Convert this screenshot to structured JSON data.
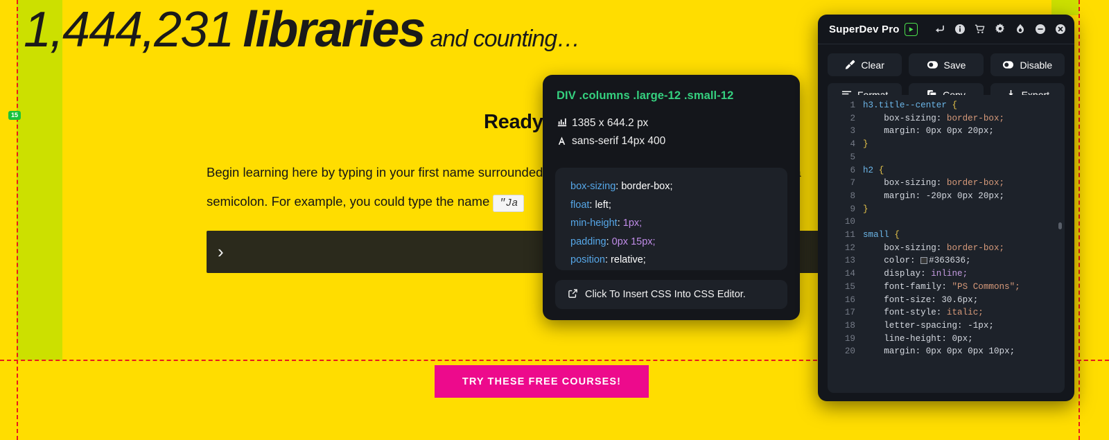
{
  "page": {
    "hero": {
      "count": "1,444,231",
      "word": "libraries",
      "tail": "and counting…"
    },
    "heading": "Ready to try",
    "body_line1": "Begin learning here by typing in your first name surrounded by double quotation marks and ending with a",
    "body_line2_pre": "semicolon. For example, you could type the name",
    "body_chip": "\"Ja",
    "terminal_prompt": "›",
    "cta_label": "TRY THESE FREE COURSES!",
    "size_badge": "15"
  },
  "tooltip": {
    "selector": "DIV .columns .large-12 .small-12",
    "size_icon": "ruler-icon",
    "size": "1385 x 644.2 px",
    "font_icon": "font-icon",
    "font": "sans-serif 14px 400",
    "declarations": [
      {
        "prop": "box-sizing",
        "value": "border-box;",
        "value_kind": "text"
      },
      {
        "prop": "float",
        "value": "left;",
        "value_kind": "text"
      },
      {
        "prop": "min-height",
        "value": "1px;",
        "value_kind": "num"
      },
      {
        "prop": "padding",
        "value": "0px 15px;",
        "value_kind": "num"
      },
      {
        "prop": "position",
        "value": "relative;",
        "value_kind": "text"
      }
    ],
    "insert_label": "Click To Insert CSS Into CSS Editor.",
    "insert_icon": "external-link-icon",
    "accent_selector_color": "#35D07F",
    "accent_prop_color": "#56A7E8"
  },
  "panel": {
    "title": "SuperDev Pro",
    "logo_icon": "superdev-logo-icon",
    "header_icons": [
      {
        "name": "undo-icon",
        "title": "Undo"
      },
      {
        "name": "info-icon",
        "title": "Info"
      },
      {
        "name": "cart-icon",
        "title": "Cart"
      },
      {
        "name": "gear-icon",
        "title": "Settings"
      },
      {
        "name": "flame-icon",
        "title": "Hot"
      },
      {
        "name": "minimize-icon",
        "title": "Minimize"
      },
      {
        "name": "close-icon",
        "title": "Close"
      }
    ],
    "buttons": [
      {
        "label": "Clear",
        "icon": "brush-icon"
      },
      {
        "label": "Save",
        "icon": "toggle-icon"
      },
      {
        "label": "Disable",
        "icon": "toggle-icon"
      },
      {
        "label": "Format",
        "icon": "format-lines-icon"
      },
      {
        "label": "Copy",
        "icon": "copy-icon"
      },
      {
        "label": "Export",
        "icon": "download-icon"
      }
    ],
    "editor": {
      "lines": [
        {
          "n": "1",
          "tokens": [
            {
              "t": "h3.title--center ",
              "c": "c-sel"
            },
            {
              "t": "{",
              "c": "c-brace"
            }
          ]
        },
        {
          "n": "2",
          "tokens": [
            {
              "t": "    box-sizing: ",
              "c": "c-prop"
            },
            {
              "t": "border-box;",
              "c": "c-val"
            }
          ]
        },
        {
          "n": "3",
          "tokens": [
            {
              "t": "    margin: ",
              "c": "c-prop"
            },
            {
              "t": "0px 0px 20px;",
              "c": "c-num"
            }
          ]
        },
        {
          "n": "4",
          "tokens": [
            {
              "t": "}",
              "c": "c-brace"
            }
          ]
        },
        {
          "n": "5",
          "tokens": []
        },
        {
          "n": "6",
          "tokens": [
            {
              "t": "h2 ",
              "c": "c-sel"
            },
            {
              "t": "{",
              "c": "c-brace"
            }
          ]
        },
        {
          "n": "7",
          "tokens": [
            {
              "t": "    box-sizing: ",
              "c": "c-prop"
            },
            {
              "t": "border-box;",
              "c": "c-val"
            }
          ]
        },
        {
          "n": "8",
          "tokens": [
            {
              "t": "    margin: ",
              "c": "c-prop"
            },
            {
              "t": "-20px 0px 20px;",
              "c": "c-num"
            }
          ]
        },
        {
          "n": "9",
          "tokens": [
            {
              "t": "}",
              "c": "c-brace"
            }
          ]
        },
        {
          "n": "10",
          "tokens": []
        },
        {
          "n": "11",
          "tokens": [
            {
              "t": "small ",
              "c": "c-sel"
            },
            {
              "t": "{",
              "c": "c-brace"
            }
          ]
        },
        {
          "n": "12",
          "tokens": [
            {
              "t": "    box-sizing: ",
              "c": "c-prop"
            },
            {
              "t": "border-box;",
              "c": "c-val"
            }
          ]
        },
        {
          "n": "13",
          "tokens": [
            {
              "t": "    color: ",
              "c": "c-prop"
            },
            {
              "t": "SWATCH",
              "c": "swatch"
            },
            {
              "t": "#363636;",
              "c": "c-num"
            }
          ]
        },
        {
          "n": "14",
          "tokens": [
            {
              "t": "    display: ",
              "c": "c-prop"
            },
            {
              "t": "inline;",
              "c": "c-kw"
            }
          ]
        },
        {
          "n": "15",
          "tokens": [
            {
              "t": "    font-family: ",
              "c": "c-prop"
            },
            {
              "t": "\"PS Commons\";",
              "c": "c-str"
            }
          ]
        },
        {
          "n": "16",
          "tokens": [
            {
              "t": "    font-size: ",
              "c": "c-prop"
            },
            {
              "t": "30.6px;",
              "c": "c-num"
            }
          ]
        },
        {
          "n": "17",
          "tokens": [
            {
              "t": "    font-style: ",
              "c": "c-prop"
            },
            {
              "t": "italic;",
              "c": "c-val"
            }
          ]
        },
        {
          "n": "18",
          "tokens": [
            {
              "t": "    letter-spacing: ",
              "c": "c-prop"
            },
            {
              "t": "-1px;",
              "c": "c-num"
            }
          ]
        },
        {
          "n": "19",
          "tokens": [
            {
              "t": "    line-height: ",
              "c": "c-prop"
            },
            {
              "t": "0px;",
              "c": "c-num"
            }
          ]
        },
        {
          "n": "20",
          "tokens": [
            {
              "t": "    margin: ",
              "c": "c-prop"
            },
            {
              "t": "0px 0px 0px 10px;",
              "c": "c-num"
            }
          ]
        }
      ]
    }
  },
  "colors": {
    "page_bg": "#FFDD00",
    "hover_highlight": "#CCE000",
    "guide": "#E81B1B",
    "cta": "#ED0A8C",
    "panel_bg": "#13161C",
    "tooltip_bg": "#14161B",
    "editor_bg": "#1D222A",
    "badge_green": "#19C23C"
  }
}
